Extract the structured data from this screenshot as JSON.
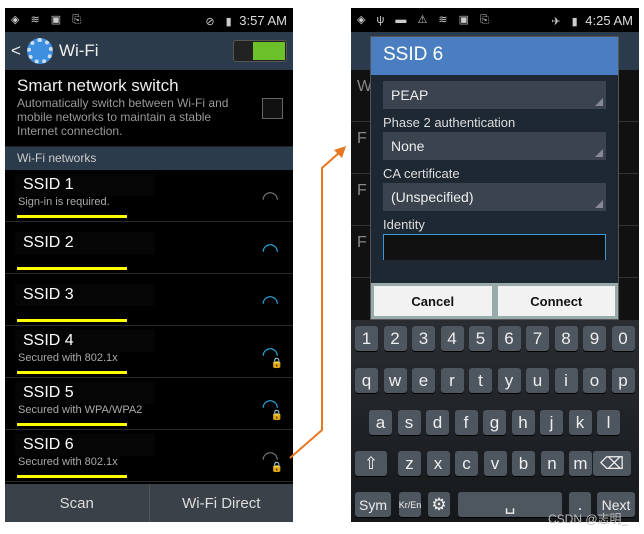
{
  "left": {
    "status": {
      "icons": [
        "wifi-calling-icon",
        "wifi-icon",
        "image-icon",
        "download-icon",
        "mute-icon",
        "blocked-icon",
        "battery-icon"
      ],
      "time": "3:57 AM"
    },
    "header": {
      "title": "Wi-Fi",
      "toggle_on": true
    },
    "smart": {
      "title": "Smart network switch",
      "desc": "Automatically switch between Wi-Fi and mobile networks to maintain a stable Internet connection.",
      "checked": false
    },
    "section": "Wi-Fi networks",
    "networks": [
      {
        "ssid": "SSID 1",
        "sub": "Sign-in is required.",
        "secured": false,
        "grey": true
      },
      {
        "ssid": "SSID 2",
        "sub": "",
        "secured": false,
        "grey": false
      },
      {
        "ssid": "SSID 3",
        "sub": "",
        "secured": false,
        "grey": false
      },
      {
        "ssid": "SSID 4",
        "sub": "Secured with 802.1x",
        "secured": true,
        "grey": false
      },
      {
        "ssid": "SSID 5",
        "sub": "Secured with WPA/WPA2",
        "secured": true,
        "grey": false
      },
      {
        "ssid": "SSID 6",
        "sub": "Secured with 802.1x",
        "secured": true,
        "grey": true
      }
    ],
    "bottom": {
      "scan": "Scan",
      "direct": "Wi-Fi Direct"
    }
  },
  "right": {
    "status": {
      "time": "4:25 AM"
    },
    "dialog": {
      "title": "SSID 6",
      "eap": "PEAP",
      "phase2_label": "Phase 2 authentication",
      "phase2": "None",
      "ca_label": "CA certificate",
      "ca": "(Unspecified)",
      "identity_label": "Identity",
      "identity": "",
      "cancel": "Cancel",
      "connect": "Connect"
    },
    "keyboard": {
      "rows": [
        [
          "1",
          "2",
          "3",
          "4",
          "5",
          "6",
          "7",
          "8",
          "9",
          "0"
        ],
        [
          "q",
          "w",
          "e",
          "r",
          "t",
          "y",
          "u",
          "i",
          "o",
          "p"
        ],
        [
          "a",
          "s",
          "d",
          "f",
          "g",
          "h",
          "j",
          "k",
          "l"
        ],
        [
          "⇧",
          "z",
          "x",
          "c",
          "v",
          "b",
          "n",
          "m",
          "⌫"
        ],
        [
          "Sym",
          "Kr/En",
          "⚙",
          "␣",
          ".",
          "Next"
        ]
      ]
    }
  },
  "watermark": "CSDN @志明_",
  "colors": {
    "accent": "#2aa8e0",
    "highlight": "#ffff00",
    "arrow": "#e87722",
    "dialog_title": "#4a7ec0"
  }
}
